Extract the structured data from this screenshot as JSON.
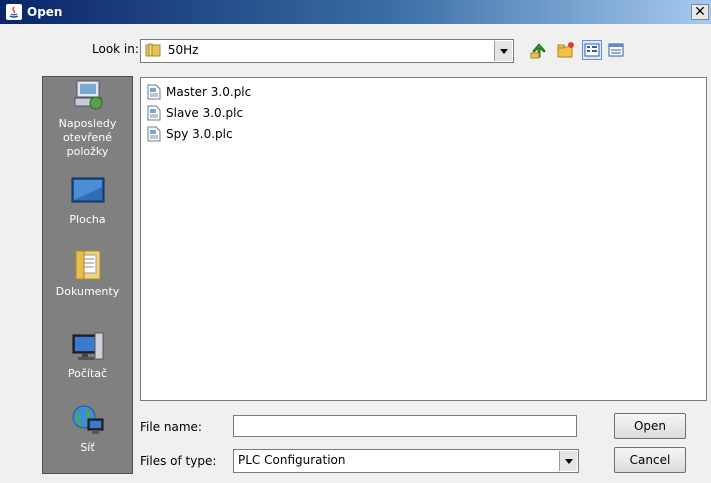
{
  "window": {
    "title": "Open",
    "close_glyph": "✕"
  },
  "look_in": {
    "label": "Look in:",
    "value": "50Hz"
  },
  "toolbar": {
    "icons": [
      "up-one-level-icon",
      "create-new-folder-icon",
      "list-view-icon",
      "details-view-icon"
    ]
  },
  "sidebar": {
    "items": [
      {
        "label": "Naposledy otevřené položky",
        "icon": "recent-items-icon"
      },
      {
        "label": "Plocha",
        "icon": "desktop-icon"
      },
      {
        "label": "Dokumenty",
        "icon": "documents-folder-icon"
      },
      {
        "label": "Počítač",
        "icon": "computer-icon"
      },
      {
        "label": "Síť",
        "icon": "network-icon"
      }
    ]
  },
  "files": [
    {
      "name": "Master 3.0.plc"
    },
    {
      "name": "Slave 3.0.plc"
    },
    {
      "name": "Spy 3.0.plc"
    }
  ],
  "file_name": {
    "label": "File name:",
    "value": ""
  },
  "file_type": {
    "label": "Files of type:",
    "value": "PLC Configuration"
  },
  "buttons": {
    "open": "Open",
    "cancel": "Cancel"
  },
  "colors": {
    "sidebar_bg": "#808080",
    "title_start": "#0a246a",
    "title_end": "#a6caf0"
  }
}
